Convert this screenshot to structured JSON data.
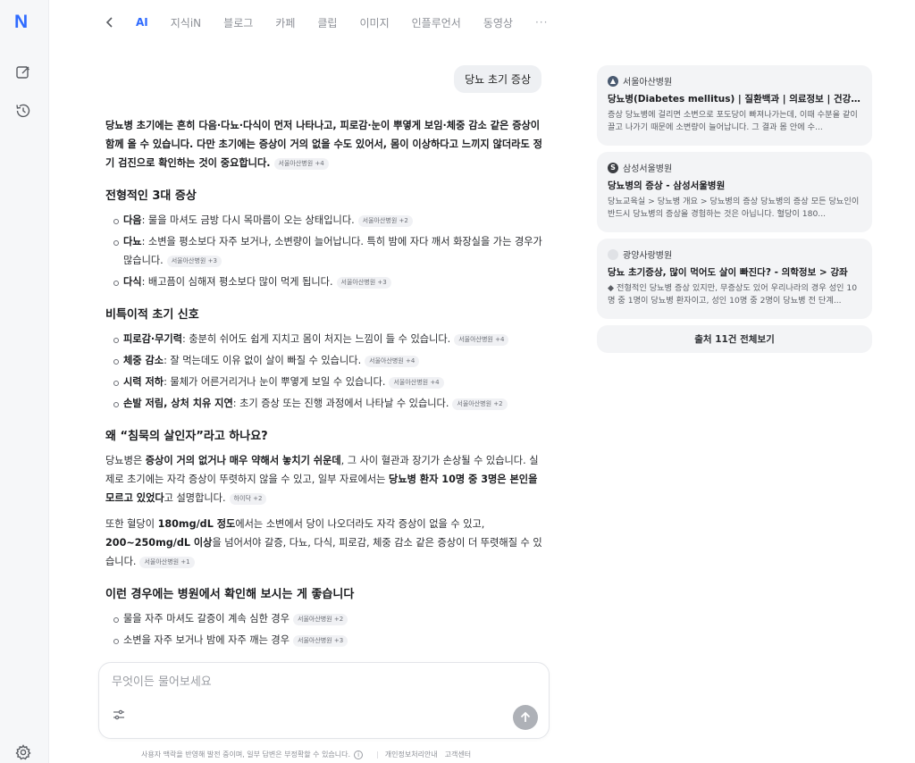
{
  "rail": {
    "logo": "N",
    "icons": [
      "new-chat-icon",
      "history-icon",
      "settings-icon"
    ]
  },
  "tabs": [
    {
      "label": "AI",
      "active": true
    },
    {
      "label": "지식iN"
    },
    {
      "label": "블로그"
    },
    {
      "label": "카페"
    },
    {
      "label": "클립"
    },
    {
      "label": "이미지"
    },
    {
      "label": "인플루언서"
    },
    {
      "label": "동영상"
    }
  ],
  "tabs_more": "···",
  "query": "당뇨 초기 증상",
  "answer": {
    "intro_a": "당뇨병 초기에는 흔히 다음·다뇨·다식이 먼저 나타나고, 피로감·눈이 뿌옇게 보임·체중 감소 같은 증상이 함께 올 수 있습니다. 다만 초기에는 증상이 거의 없을 수도 있어서, 몸이 이상하다고 느끼지 않더라도 정기 검진으로 확인하는 것이 중요합니다.",
    "intro_cite": "서울아산병원 +4",
    "s1_title": "전형적인 3대 증상",
    "s1_items": [
      {
        "bold": "다음",
        "text": ": 물을 마셔도 금방 다시 목마름이 오는 상태입니다.",
        "cite": "서울아산병원 +2"
      },
      {
        "bold": "다뇨",
        "text": ": 소변을 평소보다 자주 보거나, 소변량이 늘어납니다. 특히 밤에 자다 깨서 화장실을 가는 경우가 많습니다.",
        "cite": "서울아산병원 +3"
      },
      {
        "bold": "다식",
        "text": ": 배고픔이 심해져 평소보다 많이 먹게 됩니다.",
        "cite": "서울아산병원 +3"
      }
    ],
    "s2_title": "비특이적 초기 신호",
    "s2_items": [
      {
        "bold": "피로감·무기력",
        "text": ": 충분히 쉬어도 쉽게 지치고 몸이 처지는 느낌이 들 수 있습니다.",
        "cite": "서울아산병원 +4"
      },
      {
        "bold": "체중 감소",
        "text": ": 잘 먹는데도 이유 없이 살이 빠질 수 있습니다.",
        "cite": "서울아산병원 +4"
      },
      {
        "bold": "시력 저하",
        "text": ": 물체가 어른거리거나 눈이 뿌옇게 보일 수 있습니다.",
        "cite": "서울아산병원 +4"
      },
      {
        "bold": "손발 저림, 상처 치유 지연",
        "text": ": 초기 증상 또는 진행 과정에서 나타날 수 있습니다.",
        "cite": "서울아산병원 +2"
      }
    ],
    "s3_title": "왜 “침묵의 살인자”라고 하나요?",
    "s3_p1": {
      "t1": "당뇨병은 ",
      "b1": "증상이 거의 없거나 매우 약해서 놓치기 쉬운데",
      "t2": ", 그 사이 혈관과 장기가 손상될 수 있습니다. 실제로 초기에는 자각 증상이 뚜렷하지 않을 수 있고, 일부 자료에서는 ",
      "b2": "당뇨병 환자 10명 중 3명은 본인을 모르고 있었다",
      "t3": "고 설명합니다.",
      "cite": "하이닥 +2"
    },
    "s3_p2": {
      "t1": "또한 혈당이 ",
      "b1": "180mg/dL 정도",
      "t2": "에서는 소변에서 당이 나오더라도 자각 증상이 없을 수 있고, ",
      "b2": "200~250mg/dL 이상",
      "t3": "을 넘어서야 갈증, 다뇨, 다식, 피로감, 체중 감소 같은 증상이 더 뚜렷해질 수 있습니다.",
      "cite": "서울아산병원 +1"
    },
    "s4_title": "이런 경우에는 병원에서 확인해 보시는 게 좋습니다",
    "s4_items": [
      {
        "text": "물을 자주 마셔도 갈증이 계속 심한 경우",
        "cite": "서울아산병원 +2"
      },
      {
        "text": "소변을 자주 보거나 밤에 자주 깨는 경우",
        "cite": "서울아산병원 +3"
      }
    ]
  },
  "input": {
    "placeholder": "무엇이든 물어보세요"
  },
  "footer": {
    "notice": "사용자 맥락을 반영해 발전 중이며, 일부 답변은 부정확할 수 있습니다.",
    "info_icon": "i",
    "privacy": "개인정보처리안내",
    "support": "고객센터"
  },
  "sources": [
    {
      "site": "서울아산병원",
      "icon_color": "#4a5a70",
      "icon_glyph": "▲",
      "title": "당뇨병(Diabetes mellitus) | 질환백과 | 의료정보 | 건강정보",
      "desc": "증상 당뇨병에 걸리면 소변으로 포도당이 빠져나가는데, 이때 수분을 같이 끌고 나가기 때문에 소변량이 늘어납니다. 그 결과 몸 안에 수..."
    },
    {
      "site": "삼성서울병원",
      "icon_color": "#3b3d42",
      "icon_glyph": "S",
      "title": "당뇨병의 증상 - 삼성서울병원",
      "desc": "당뇨교육실 > 당뇨병 개요 > 당뇨병의 증상 당뇨병의 증상 모든 당뇨인이 반드시 당뇨병의 증상을 경험하는 것은 아닙니다. 혈당이 180..."
    },
    {
      "site": "광양사랑병원",
      "icon_color": "#e0e2e6",
      "icon_glyph": "",
      "title": "당뇨 초기증상, 많이 먹어도 살이 빠진다? - 의학정보 > 강좌",
      "desc": "◆ 전형적인 당뇨병 증상 있지만, 무증상도 있어 우리나라의 경우 성인 10명 중 1명이 당뇨병 환자이고, 성인 10명 중 2명이 당뇨병 전 단계..."
    }
  ],
  "sources_all": "출처 11건 전체보기",
  "colors": {
    "accent": "#2f6bff",
    "card_bg": "#f3f4f6"
  }
}
